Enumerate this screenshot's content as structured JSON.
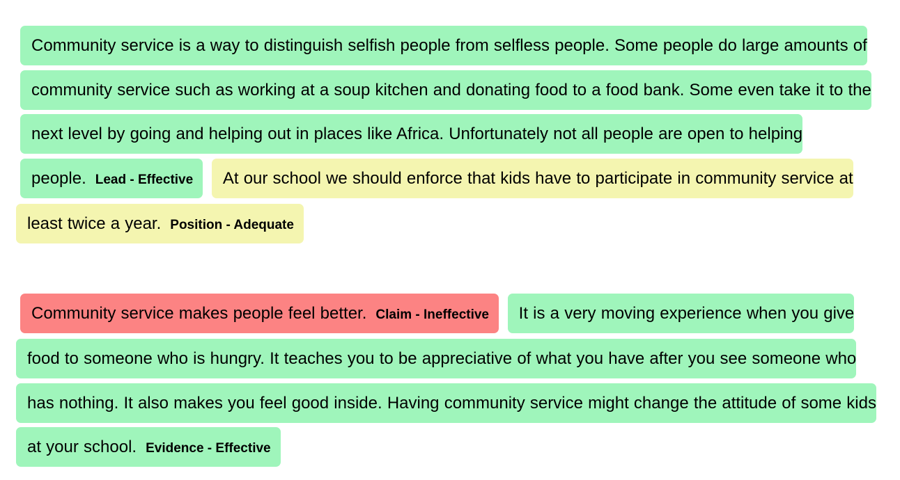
{
  "colors": {
    "effective": "#9ff5bb",
    "adequate": "#f4f5b0",
    "ineffective": "#fc8383"
  },
  "paragraphs": [
    {
      "segments": [
        {
          "text": "Community service is a way to distinguish selfish people from selfless people. Some people do large amounts of community service such as working at a soup kitchen and donating food to a food bank. Some even take it to the next level by going and helping out in places like Africa. Unfortunately not all people are open to helping people.",
          "label": "Lead - Effective",
          "rating": "effective"
        },
        {
          "text": "At our school we should enforce that kids have to participate in community service at least twice a year.",
          "label": "Position - Adequate",
          "rating": "adequate"
        }
      ]
    },
    {
      "segments": [
        {
          "text": "Community service makes people feel better.",
          "label": "Claim - Ineffective",
          "rating": "ineffective"
        },
        {
          "text": "It is a very moving experience when you give food to someone who is hungry. It teaches you to be appreciative of what you have after you see someone who has nothing. It also makes you feel good inside. Having community service might change the attitude of some kids at your school.",
          "label": "Evidence - Effective",
          "rating": "effective"
        }
      ]
    }
  ]
}
